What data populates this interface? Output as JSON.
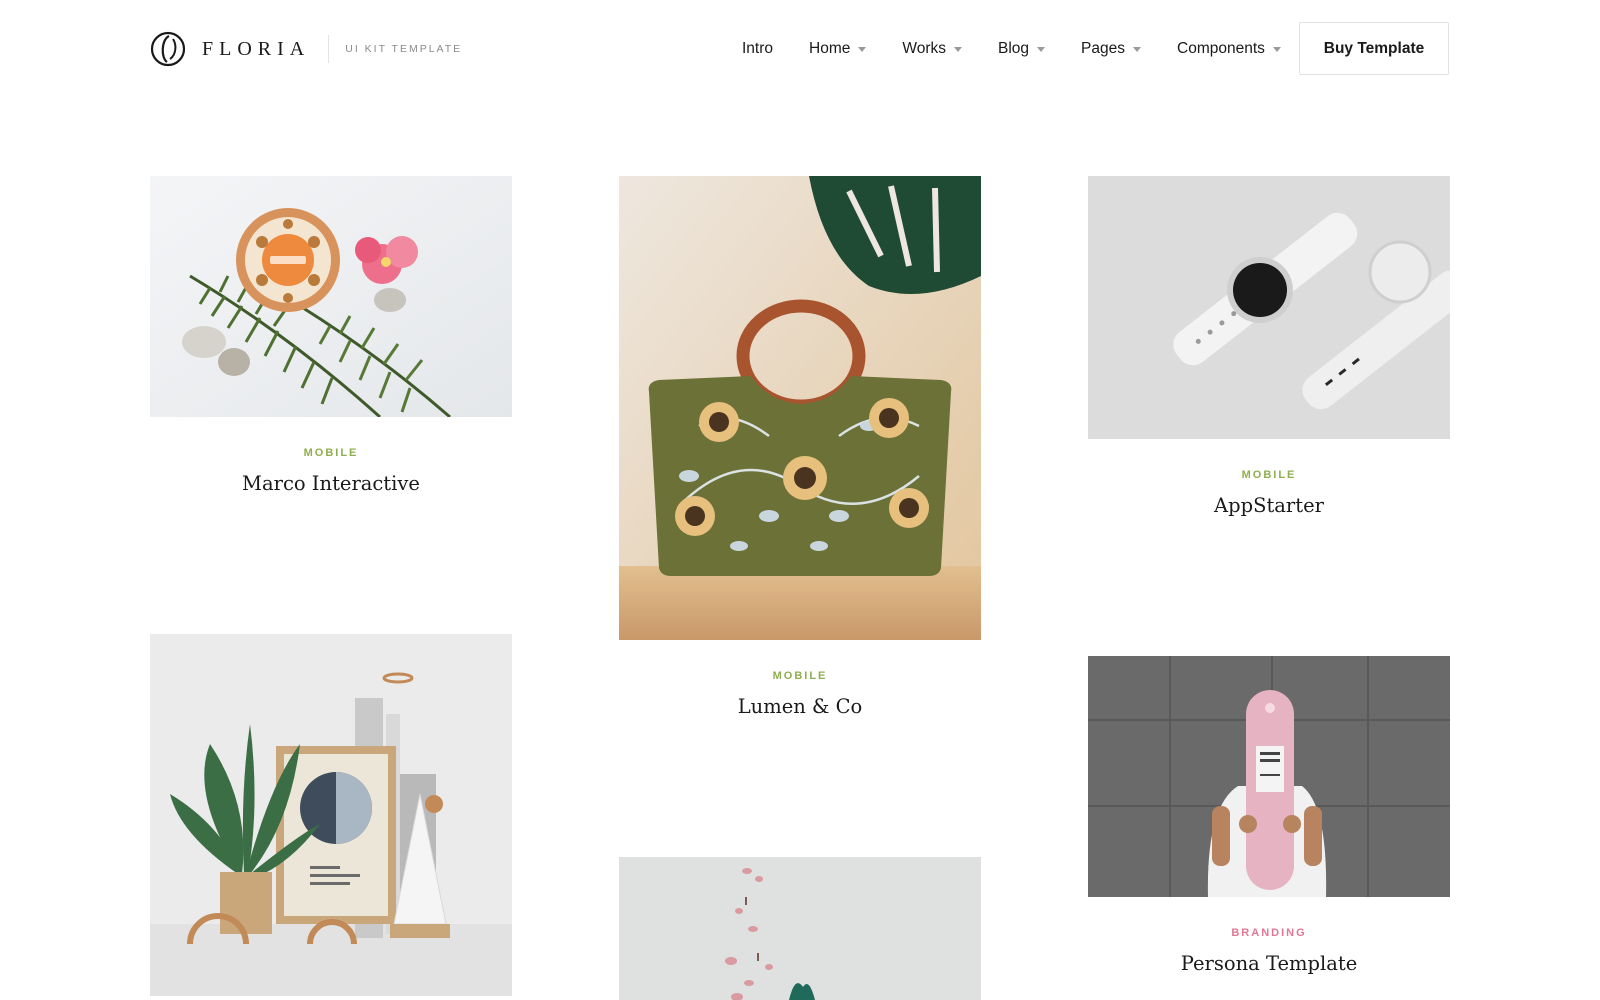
{
  "brand": {
    "name": "FLORIA",
    "tagline": "UI KIT TEMPLATE",
    "logo_icon": "floria-logo-icon"
  },
  "nav": {
    "items": [
      {
        "label": "Intro",
        "has_dropdown": false
      },
      {
        "label": "Home",
        "has_dropdown": true
      },
      {
        "label": "Works",
        "has_dropdown": true
      },
      {
        "label": "Blog",
        "has_dropdown": true
      },
      {
        "label": "Pages",
        "has_dropdown": true
      },
      {
        "label": "Components",
        "has_dropdown": true
      }
    ],
    "cta_label": "Buy Template"
  },
  "colors": {
    "mobile_category": "#8fae4f",
    "branding_category": "#e07896",
    "text": "#1a1a1a"
  },
  "portfolio": {
    "items": [
      {
        "category": "MOBILE",
        "title": "Marco Interactive",
        "image": "cosmetic-powder-with-fern-photo"
      },
      {
        "category": "MOBILE",
        "title": "Lumen & Co",
        "image": "embroidered-sunflower-handbag-photo"
      },
      {
        "category": "MOBILE",
        "title": "AppStarter",
        "image": "white-smartwatch-mockup-photo"
      },
      {
        "category": "",
        "title": "",
        "image": "plant-and-framed-print-still-life-photo"
      },
      {
        "category": "",
        "title": "",
        "image": "falling-flowers-photo"
      },
      {
        "category": "BRANDING",
        "title": "Persona Template",
        "image": "person-holding-pink-skateboard-photo"
      }
    ]
  }
}
